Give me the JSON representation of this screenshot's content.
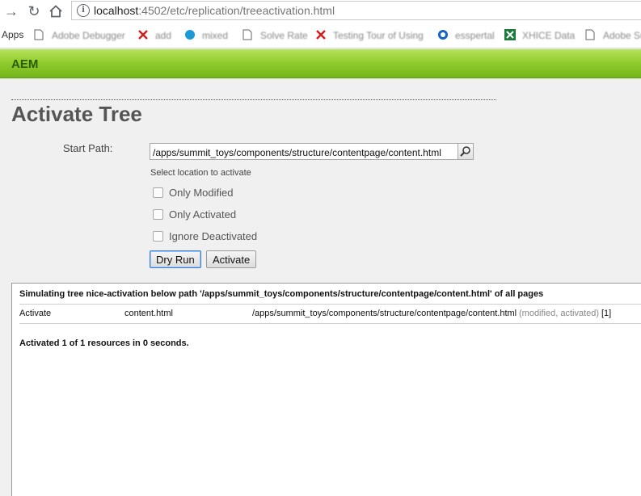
{
  "browser": {
    "url_host": "localhost",
    "url_rest": ":4502/etc/replication/treeactivation.html"
  },
  "bookmarks": {
    "apps_label": "Apps",
    "items": [
      "Adobe Debugger",
      "add",
      "mixed",
      "Solve Rate",
      "Testing Tour of Using",
      "esspertal",
      "XHICE Data",
      "Adobe Su"
    ]
  },
  "header": {
    "title": "AEM"
  },
  "form": {
    "page_title": "Activate Tree",
    "start_path_label": "Start Path:",
    "start_path_value": "/apps/summit_toys/components/structure/contentpage/content.html",
    "select_location_label": "Select location to activate",
    "options": [
      {
        "label": "Only Modified",
        "checked": false
      },
      {
        "label": "Only Activated",
        "checked": false
      },
      {
        "label": "Ignore Deactivated",
        "checked": false
      }
    ],
    "dry_run_label": "Dry Run",
    "activate_label": "Activate"
  },
  "result": {
    "heading": "Simulating tree nice-activation below path '/apps/summit_toys/components/structure/contentpage/content.html' of all pages",
    "row": {
      "action": "Activate",
      "name": "content.html",
      "path": "/apps/summit_toys/components/structure/contentpage/content.html",
      "status": "(modified, activated)",
      "count": "[1]"
    },
    "summary": "Activated 1 of 1 resources in 0 seconds."
  }
}
